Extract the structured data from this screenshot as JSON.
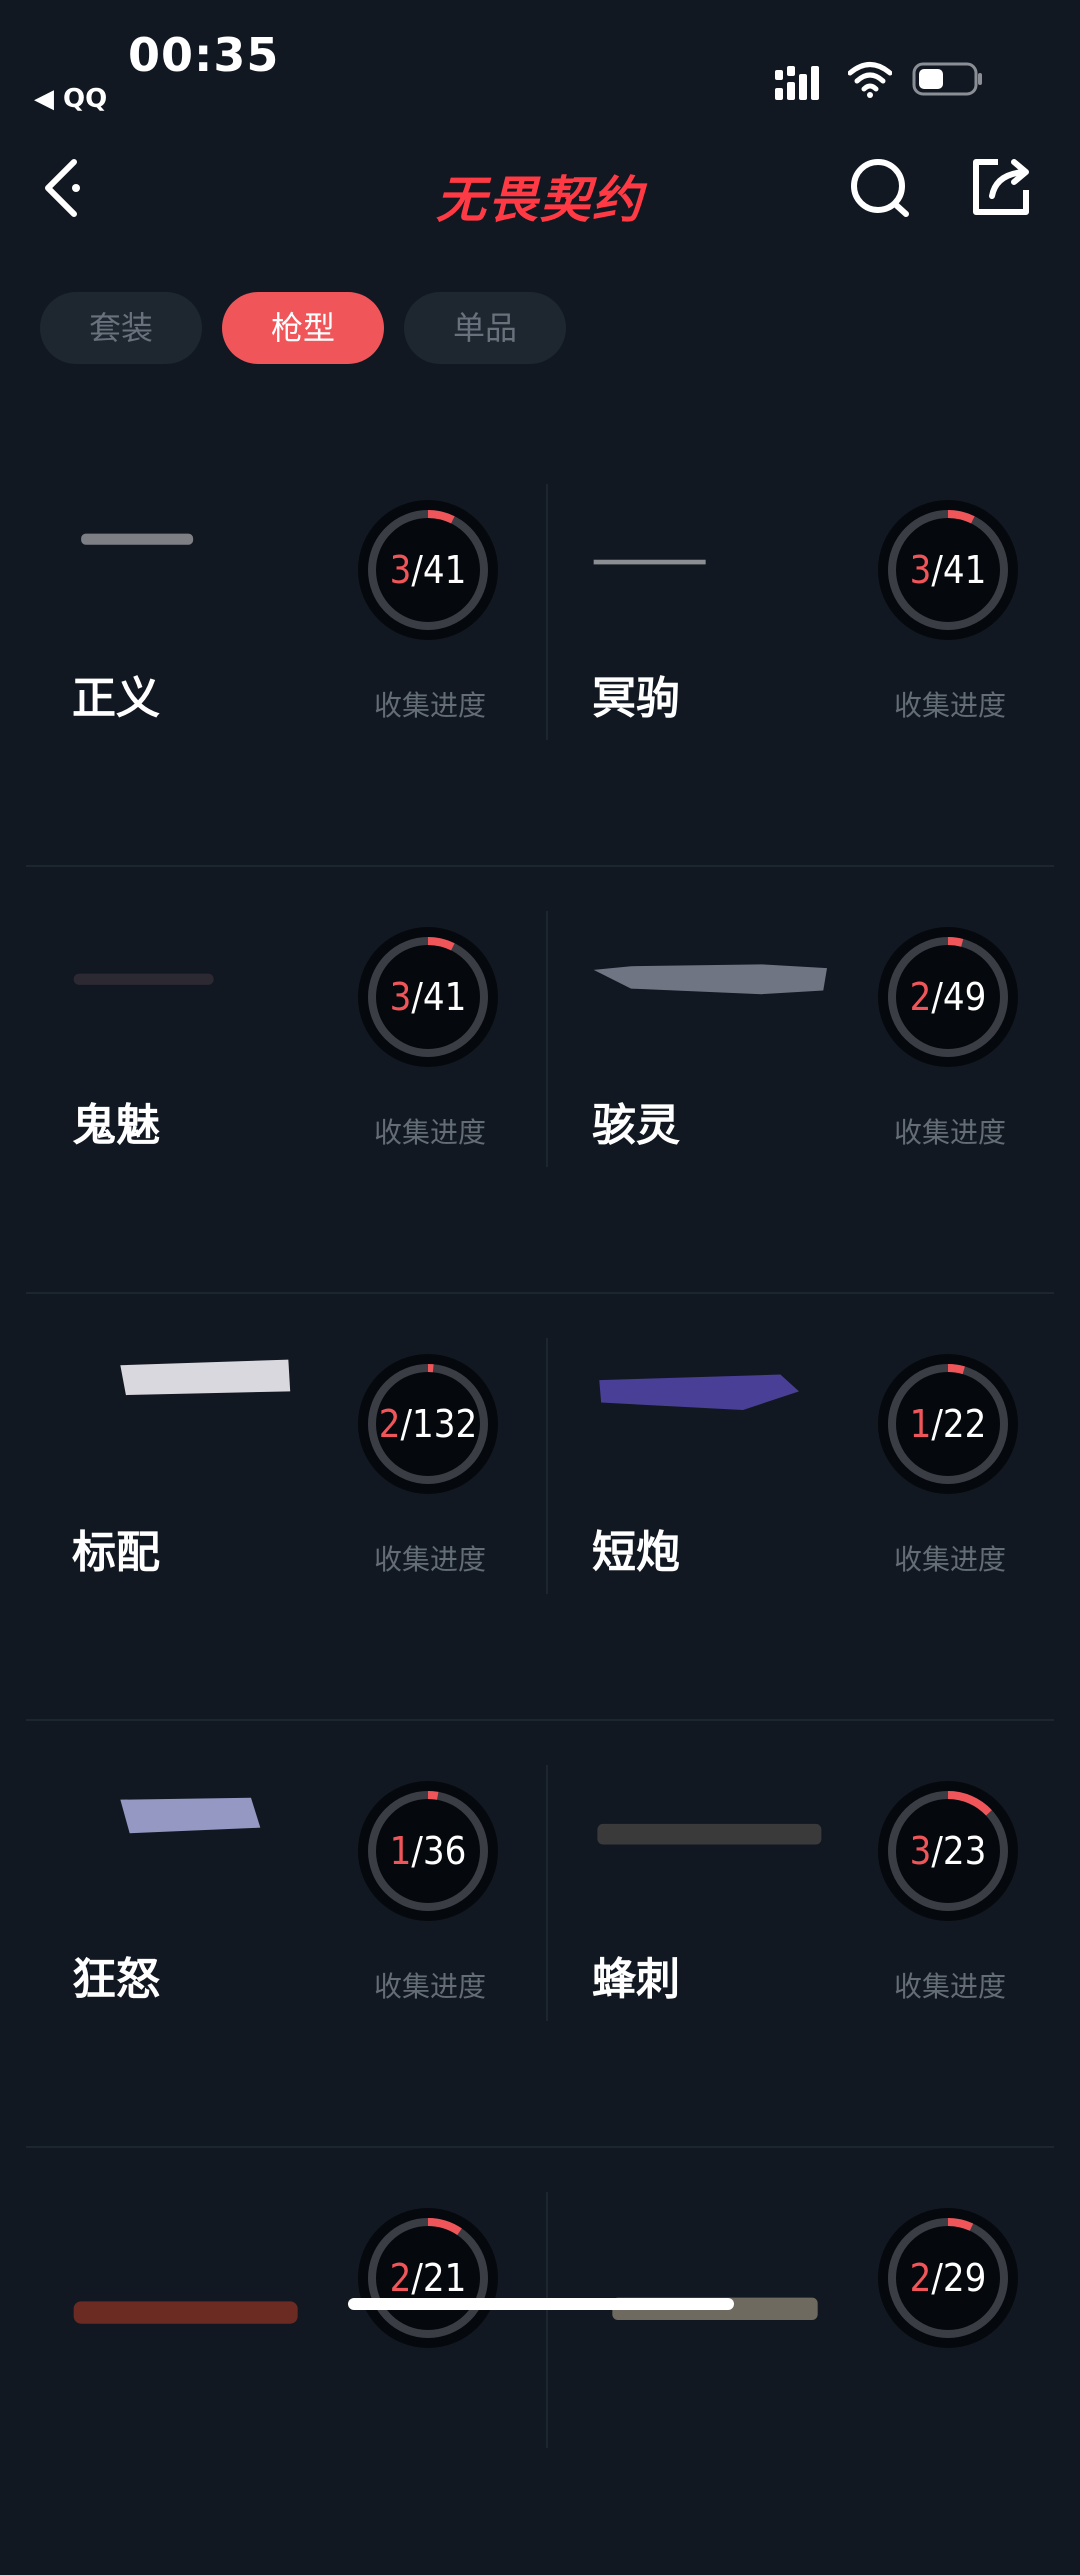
{
  "status": {
    "time": "00:35",
    "back_app": "◀ QQ"
  },
  "nav": {
    "title": "无畏契约"
  },
  "tabs": [
    {
      "label": "套装",
      "active": false
    },
    {
      "label": "枪型",
      "active": true
    },
    {
      "label": "单品",
      "active": false
    }
  ],
  "colors": {
    "accent": "#f0555a",
    "ring_track": "#3a3e44",
    "ring_progress": "#f0555a",
    "bg": "#111821"
  },
  "cards": [
    {
      "name": "正义",
      "owned": 3,
      "total": 41,
      "progress_label": "收集进度",
      "gun": "revolver-icon"
    },
    {
      "name": "冥驹",
      "owned": 3,
      "total": 41,
      "progress_label": "收集进度",
      "gun": "sniper-rifle-icon"
    },
    {
      "name": "鬼魅",
      "owned": 3,
      "total": 41,
      "progress_label": "收集进度",
      "gun": "suppressed-pistol-icon"
    },
    {
      "name": "骇灵",
      "owned": 2,
      "total": 49,
      "progress_label": "收集进度",
      "gun": "smg-icon"
    },
    {
      "name": "标配",
      "owned": 2,
      "total": 132,
      "progress_label": "收集进度",
      "gun": "pistol-icon"
    },
    {
      "name": "短炮",
      "owned": 1,
      "total": 22,
      "progress_label": "收集进度",
      "gun": "shotgun-pistol-icon"
    },
    {
      "name": "狂怒",
      "owned": 1,
      "total": 36,
      "progress_label": "收集进度",
      "gun": "machine-pistol-icon"
    },
    {
      "name": "蜂刺",
      "owned": 3,
      "total": 23,
      "progress_label": "收集进度",
      "gun": "smg-icon"
    },
    {
      "name": "",
      "owned": 2,
      "total": 21,
      "progress_label": "",
      "gun": "shotgun-icon"
    },
    {
      "name": "",
      "owned": 2,
      "total": 29,
      "progress_label": "",
      "gun": "rifle-icon"
    }
  ]
}
